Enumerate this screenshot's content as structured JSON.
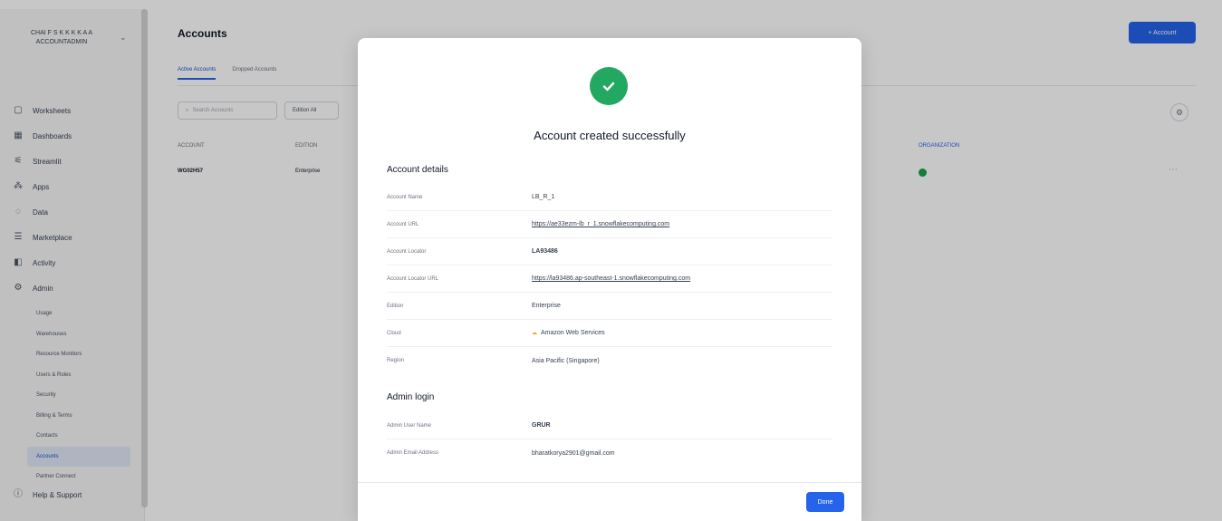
{
  "sidebar": {
    "org_name": "CHAI F S K K K K A A ACCOUNTADMIN",
    "nav": [
      {
        "label": "Worksheets",
        "icon": "worksheets-icon"
      },
      {
        "label": "Dashboards",
        "icon": "dashboards-icon"
      },
      {
        "label": "Streamlit",
        "icon": "streamlit-icon"
      },
      {
        "label": "Apps",
        "icon": "apps-icon"
      },
      {
        "label": "Data",
        "icon": "data-icon"
      },
      {
        "label": "Marketplace",
        "icon": "marketplace-icon"
      },
      {
        "label": "Activity",
        "icon": "activity-icon"
      },
      {
        "label": "Admin",
        "icon": "admin-icon"
      }
    ],
    "admin_sub": [
      "Usage",
      "Warehouses",
      "Resource Monitors",
      "Users & Roles",
      "Security",
      "Billing & Terms",
      "Contacts",
      "Accounts",
      "Partner Connect"
    ],
    "help_label": "Help & Support"
  },
  "main": {
    "title": "Accounts",
    "add_button": "+ Account",
    "tabs": [
      "Active Accounts",
      "Dropped Accounts"
    ],
    "search_placeholder": "Search Accounts",
    "filter_label": "Edition All",
    "columns": [
      "ACCOUNT",
      "EDITION"
    ],
    "status_column": "ORGANIZATION",
    "row": {
      "account": "WG02H57",
      "edition": "Enterprise"
    }
  },
  "modal": {
    "title": "Account created successfully",
    "details_title": "Account details",
    "details": [
      {
        "label": "Account Name",
        "value": "LB_R_1",
        "style": "plain"
      },
      {
        "label": "Account URL",
        "value": "https://ae33ezm-lb_r_1.snowflakecomputing.com",
        "style": "link"
      },
      {
        "label": "Account Locator",
        "value": "LA93486",
        "style": "bold"
      },
      {
        "label": "Account Locator URL",
        "value": "https://la93486.ap-southeast-1.snowflakecomputing.com",
        "style": "link"
      },
      {
        "label": "Edition",
        "value": "Enterprise",
        "style": "plain"
      },
      {
        "label": "Cloud",
        "value": "Amazon Web Services",
        "style": "cloud"
      },
      {
        "label": "Region",
        "value": "Asia Pacific (Singapore)",
        "style": "plain"
      }
    ],
    "admin_title": "Admin login",
    "admin": [
      {
        "label": "Admin User Name",
        "value": "GRUR",
        "style": "bold"
      },
      {
        "label": "Admin Email Address",
        "value": "bharatkorya2901@gmail.com",
        "style": "plain"
      }
    ],
    "done_label": "Done"
  },
  "colors": {
    "accent": "#2563eb",
    "success": "#22a861"
  }
}
